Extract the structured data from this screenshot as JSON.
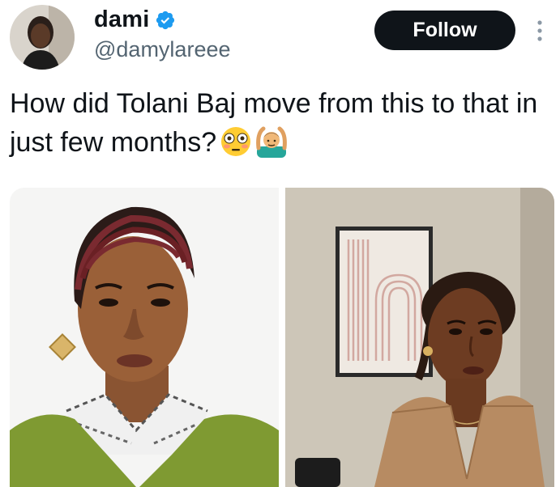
{
  "author": {
    "display_name": "dami",
    "handle": "@damylareee",
    "verified": true,
    "avatar_icon": "profile-photo"
  },
  "actions": {
    "follow_label": "Follow",
    "more_icon": "vertical-ellipsis-icon"
  },
  "tweet": {
    "text": "How did Tolani Baj move from this to that in just few months?",
    "emojis": [
      "flushed-face-emoji",
      "man-gesturing-ok-emoji"
    ]
  },
  "media": [
    {
      "icon": "photo-woman-braids-green-sweater"
    },
    {
      "icon": "photo-woman-sleek-ponytail-tan-robe"
    }
  ],
  "colors": {
    "verified_blue": "#1d9bf0",
    "follow_bg": "#0f1419",
    "follow_text": "#ffffff",
    "handle_gray": "#536471",
    "text": "#0f1419"
  }
}
